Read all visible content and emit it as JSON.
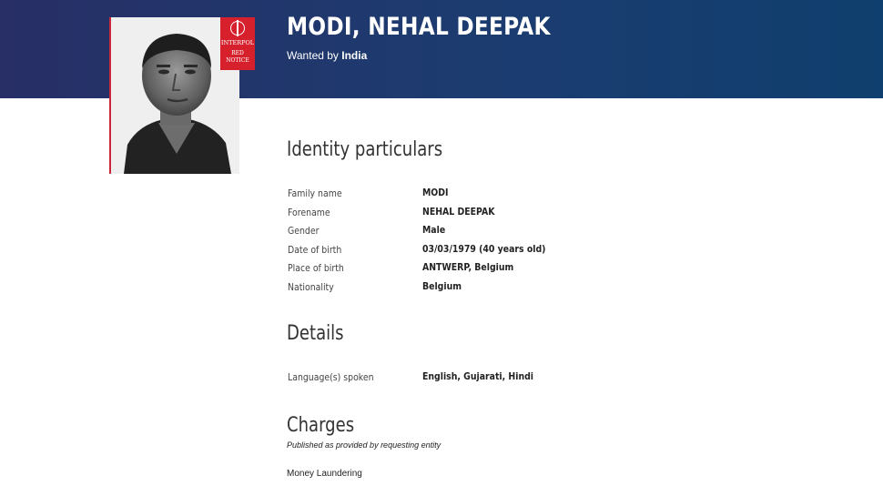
{
  "header": {
    "name": "MODI, NEHAL DEEPAK",
    "wanted_prefix": "Wanted by",
    "wanted_country": "India"
  },
  "photo": {
    "badge": {
      "org": "INTERPOL",
      "notice_line1": "RED",
      "notice_line2": "NOTICE"
    }
  },
  "identity": {
    "title": "Identity particulars",
    "rows": [
      {
        "label": "Family name",
        "value": "MODI"
      },
      {
        "label": "Forename",
        "value": "NEHAL DEEPAK"
      },
      {
        "label": "Gender",
        "value": "Male"
      },
      {
        "label": "Date of birth",
        "value": "03/03/1979 (40 years old)"
      },
      {
        "label": "Place of birth",
        "value": "ANTWERP, Belgium"
      },
      {
        "label": "Nationality",
        "value": "Belgium"
      }
    ]
  },
  "details": {
    "title": "Details",
    "rows": [
      {
        "label": "Language(s) spoken",
        "value": "English, Gujarati, Hindi"
      }
    ]
  },
  "charges": {
    "title": "Charges",
    "note": "Published as provided by requesting entity",
    "text": "Money Laundering"
  },
  "colors": {
    "header_left": "#272f66",
    "header_right": "#0f3f6e",
    "badge_red": "#d6212d"
  }
}
